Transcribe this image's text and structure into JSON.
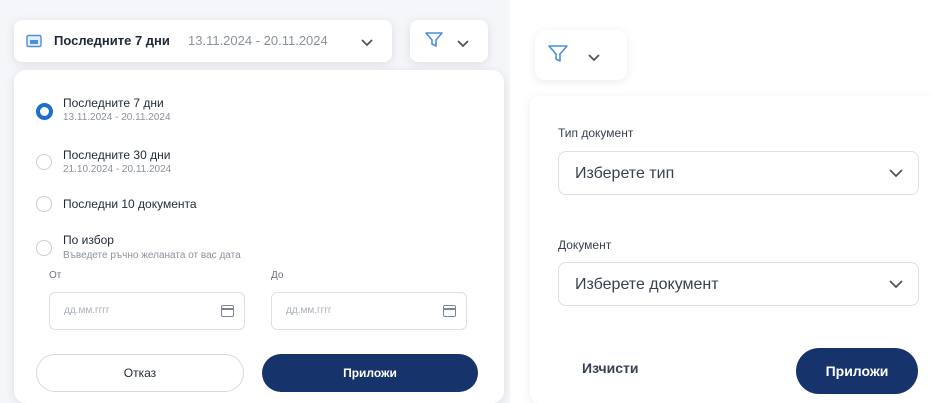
{
  "period_bar": {
    "label": "Последните 7 дни",
    "range": "13.11.2024 - 20.11.2024"
  },
  "period_menu": {
    "options": [
      {
        "title": "Последните 7 дни",
        "sub": "13.11.2024 - 20.11.2024",
        "selected": true
      },
      {
        "title": "Последните 30 дни",
        "sub": "21.10.2024 - 20.11.2024",
        "selected": false
      },
      {
        "title": "Последни 10 документа",
        "sub": "",
        "selected": false
      },
      {
        "title": "По избор",
        "sub": "Въведете ръчно желаната от вас дата",
        "selected": false
      }
    ],
    "from_label": "От",
    "to_label": "До",
    "from_placeholder": "дд.мм.гггг",
    "to_placeholder": "дд.мм.гггг",
    "cancel_label": "Отказ",
    "apply_label": "Приложи"
  },
  "filter_panel": {
    "doc_type_label": "Тип документ",
    "doc_type_value": "Изберете тип",
    "doc_label": "Документ",
    "doc_value": "Изберете документ",
    "clear_label": "Изчисти",
    "apply_label": "Приложи"
  },
  "colors": {
    "accent": "#1c6fd1",
    "primary_button": "#16346b",
    "icon_blue": "#4a8fe0"
  },
  "icons": [
    "calendar-icon",
    "chevron-down-icon",
    "filter-icon"
  ]
}
